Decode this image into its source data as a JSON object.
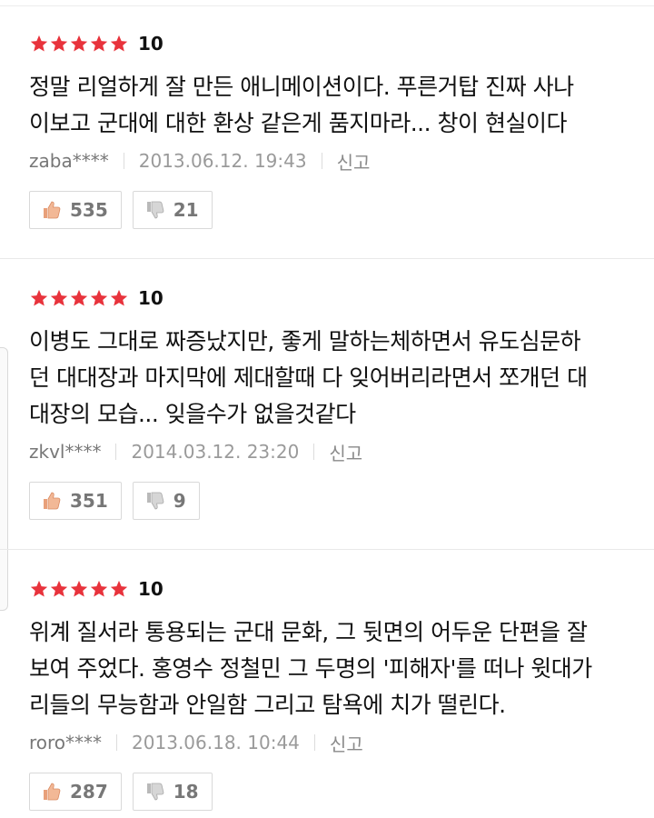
{
  "reviews": [
    {
      "score": "10",
      "stars": 5,
      "lines": [
        "정말 리얼하게 잘 만든 애니메이션이다. 푸른거탑 진짜 사나",
        "이보고 군대에 대한 환상 같은게 품지마라... 창이 현실이다"
      ],
      "user": "zaba****",
      "date": "2013.06.12. 19:43",
      "report": "신고",
      "likes": "535",
      "dislikes": "21"
    },
    {
      "score": "10",
      "stars": 5,
      "lines": [
        "이병도 그대로 짜증났지만, 좋게 말하는체하면서 유도심문하",
        "던 대대장과 마지막에 제대할때 다 잊어버리라면서 쪼개던 대",
        "대장의 모습... 잊을수가 없을것같다"
      ],
      "user": "zkvl****",
      "date": "2014.03.12. 23:20",
      "report": "신고",
      "likes": "351",
      "dislikes": "9"
    },
    {
      "score": "10",
      "stars": 5,
      "lines": [
        "위계 질서라 통용되는 군대 문화, 그 뒷면의 어두운 단편을 잘",
        "보여 주었다. 홍영수 정철민 그 두명의 '피해자'를 떠나 윗대가",
        "리들의 무능함과 안일함 그리고 탐욕에 치가 떨린다."
      ],
      "user": "roro****",
      "date": "2013.06.18. 10:44",
      "report": "신고",
      "likes": "287",
      "dislikes": "18"
    }
  ],
  "colors": {
    "star": "#e8333c",
    "thumbs_up": "#e8a07a",
    "thumbs_down": "#b9b9b9"
  },
  "icons": {
    "star": "star-icon",
    "like": "thumbs-up-icon",
    "dislike": "thumbs-down-icon"
  }
}
